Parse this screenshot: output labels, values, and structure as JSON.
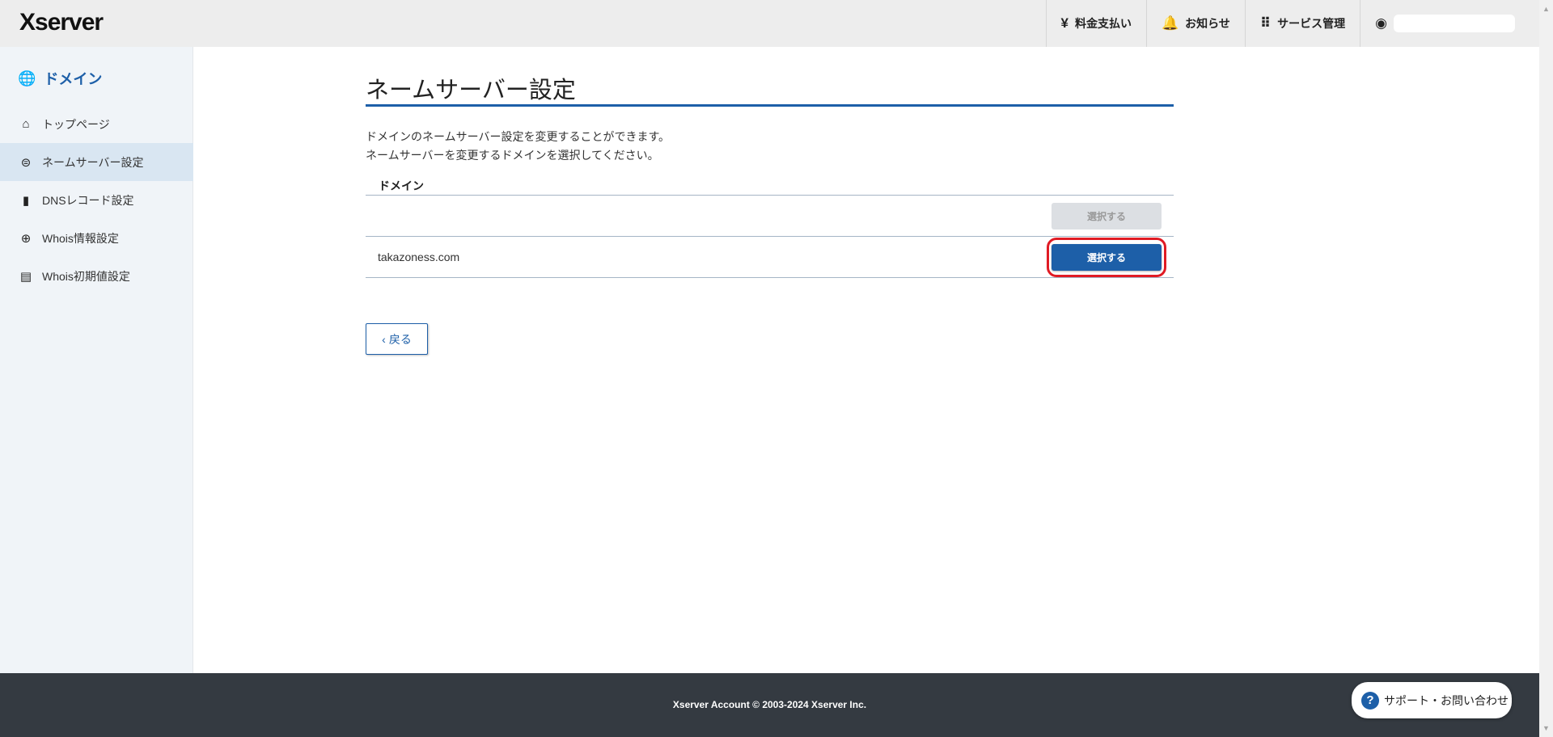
{
  "header": {
    "logo": "Xserver",
    "nav": [
      {
        "label": "料金支払い",
        "icon": "yen-icon"
      },
      {
        "label": "お知らせ",
        "icon": "bell-icon"
      },
      {
        "label": "サービス管理",
        "icon": "grid-icon"
      }
    ]
  },
  "sidebar": {
    "title": "ドメイン",
    "items": [
      {
        "label": "トップページ"
      },
      {
        "label": "ネームサーバー設定",
        "active": true
      },
      {
        "label": "DNSレコード設定"
      },
      {
        "label": "Whois情報設定"
      },
      {
        "label": "Whois初期値設定"
      }
    ]
  },
  "main": {
    "title": "ネームサーバー設定",
    "desc1": "ドメインのネームサーバー設定を変更することができます。",
    "desc2": "ネームサーバーを変更するドメインを選択してください。",
    "table": {
      "header": "ドメイン",
      "rows": [
        {
          "domain": "",
          "button": "選択する",
          "disabled": true
        },
        {
          "domain": "takazoness.com",
          "button": "選択する",
          "disabled": false
        }
      ]
    },
    "back_label": "戻る"
  },
  "footer": {
    "copyright": "Xserver Account © 2003-2024 Xserver Inc.",
    "support_label": "サポート・お問い合わせ"
  },
  "colors": {
    "accent": "#1d5fa8",
    "highlight": "#e01b24",
    "footer": "#343a41"
  }
}
